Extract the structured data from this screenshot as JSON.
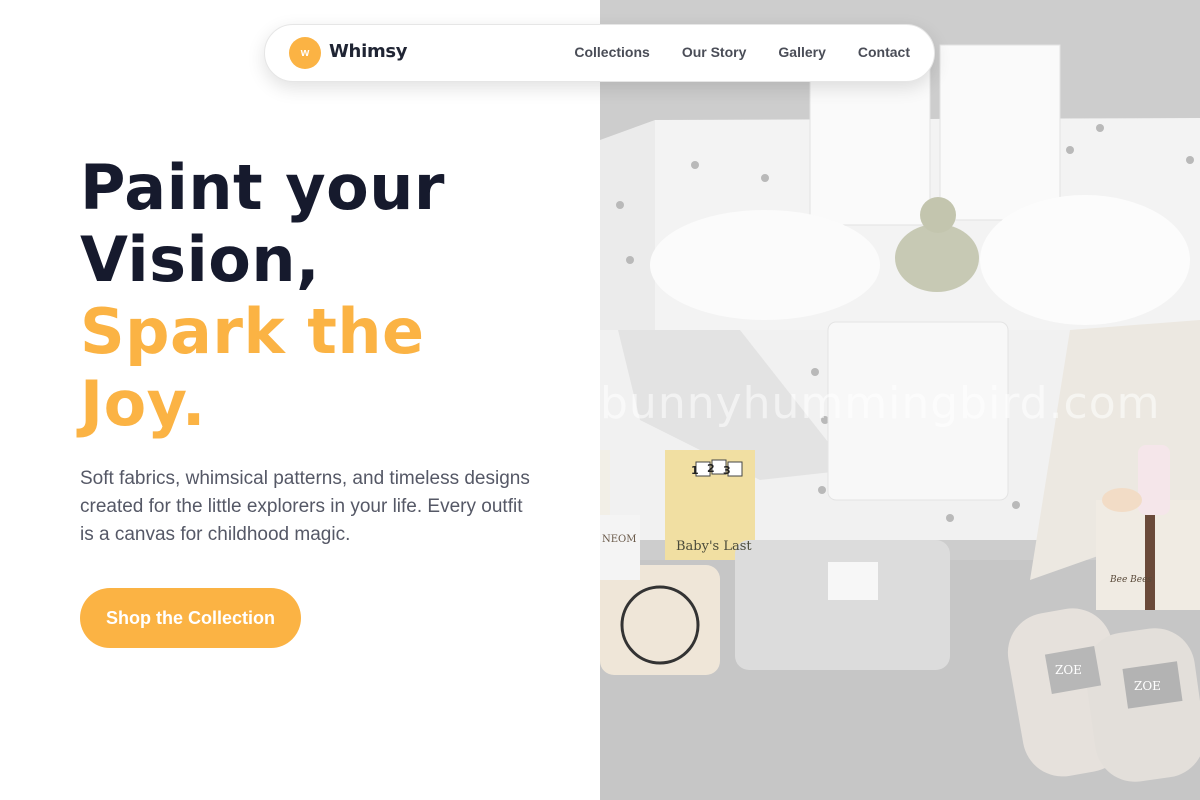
{
  "brand": {
    "logo_letter": "w",
    "name": "Whimsy",
    "accent_color": "#fbb344"
  },
  "nav": {
    "items": [
      {
        "label": "Collections"
      },
      {
        "label": "Our Story"
      },
      {
        "label": "Gallery"
      },
      {
        "label": "Contact"
      }
    ]
  },
  "hero": {
    "headline_line1": "Paint your",
    "headline_line2": "Vision,",
    "headline_line3": "Spark the",
    "headline_line4": "Joy.",
    "subtext": "Soft fabrics, whimsical patterns, and timeless designs created for the little explorers in your life. Every outfit is a canvas for childhood magic.",
    "cta_label": "Shop the Collection"
  },
  "photo": {
    "watermark": "bunnyhummingbird.com",
    "book_numbers": [
      "1",
      "2",
      "3"
    ],
    "book_title": "Baby's Last",
    "tin_label": "Bee Bees",
    "blanket_brand": "ZOE",
    "jar_label": "NEOM"
  }
}
